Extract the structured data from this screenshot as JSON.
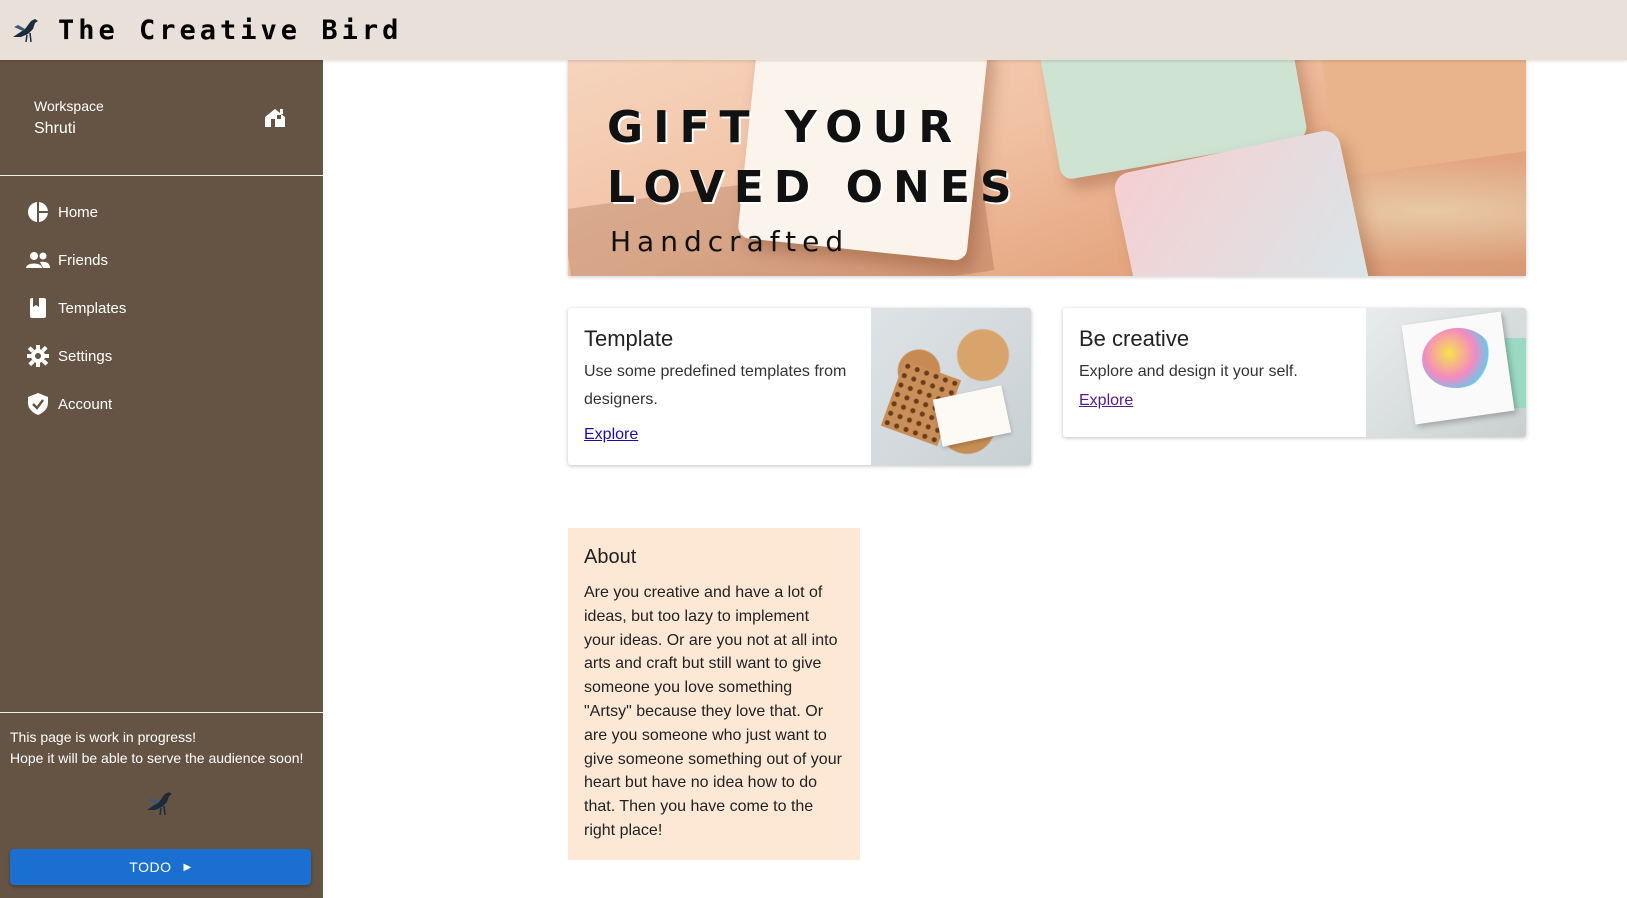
{
  "header": {
    "title": "The Creative Bird",
    "logo_icon": "bird-logo-icon"
  },
  "sidebar": {
    "workspace_label": "Workspace",
    "workspace_name": "Shruti",
    "workspace_icon": "home-switch-icon",
    "items": [
      {
        "label": "Home",
        "icon": "pie-chart-icon"
      },
      {
        "label": "Friends",
        "icon": "people-icon"
      },
      {
        "label": "Templates",
        "icon": "bookmark-book-icon"
      },
      {
        "label": "Settings",
        "icon": "gear-icon"
      },
      {
        "label": "Account",
        "icon": "verified-shield-icon"
      }
    ],
    "footer_line1": "This page is work in progress!",
    "footer_line2": "Hope it will be able to serve the audience soon!",
    "todo_label": "TODO",
    "todo_icon": "caret-right-icon"
  },
  "banner": {
    "line1": "GIFT YOUR",
    "line2": "LOVED ONES",
    "subtitle": "Handcrafted"
  },
  "cards": [
    {
      "title": "Template",
      "text": "Use some predefined templates from designers.",
      "link": "Explore"
    },
    {
      "title": "Be creative",
      "text": "Explore and design it your self.",
      "link": "Explore"
    }
  ],
  "about": {
    "title": "About",
    "text": "Are you creative and have a lot of ideas, but too lazy to implement your ideas. Or are you not at all into arts and craft but still want to give someone you love something \"Artsy\" because they love that. Or are you someone who just want to give someone something out of your heart but have no idea how to do that. Then you have come to the right place!"
  },
  "colors": {
    "sidebar_bg": "#655343",
    "topbar_bg": "#e8e0d9",
    "button_blue": "#1a6fd1",
    "about_bg": "#fde8d6"
  }
}
